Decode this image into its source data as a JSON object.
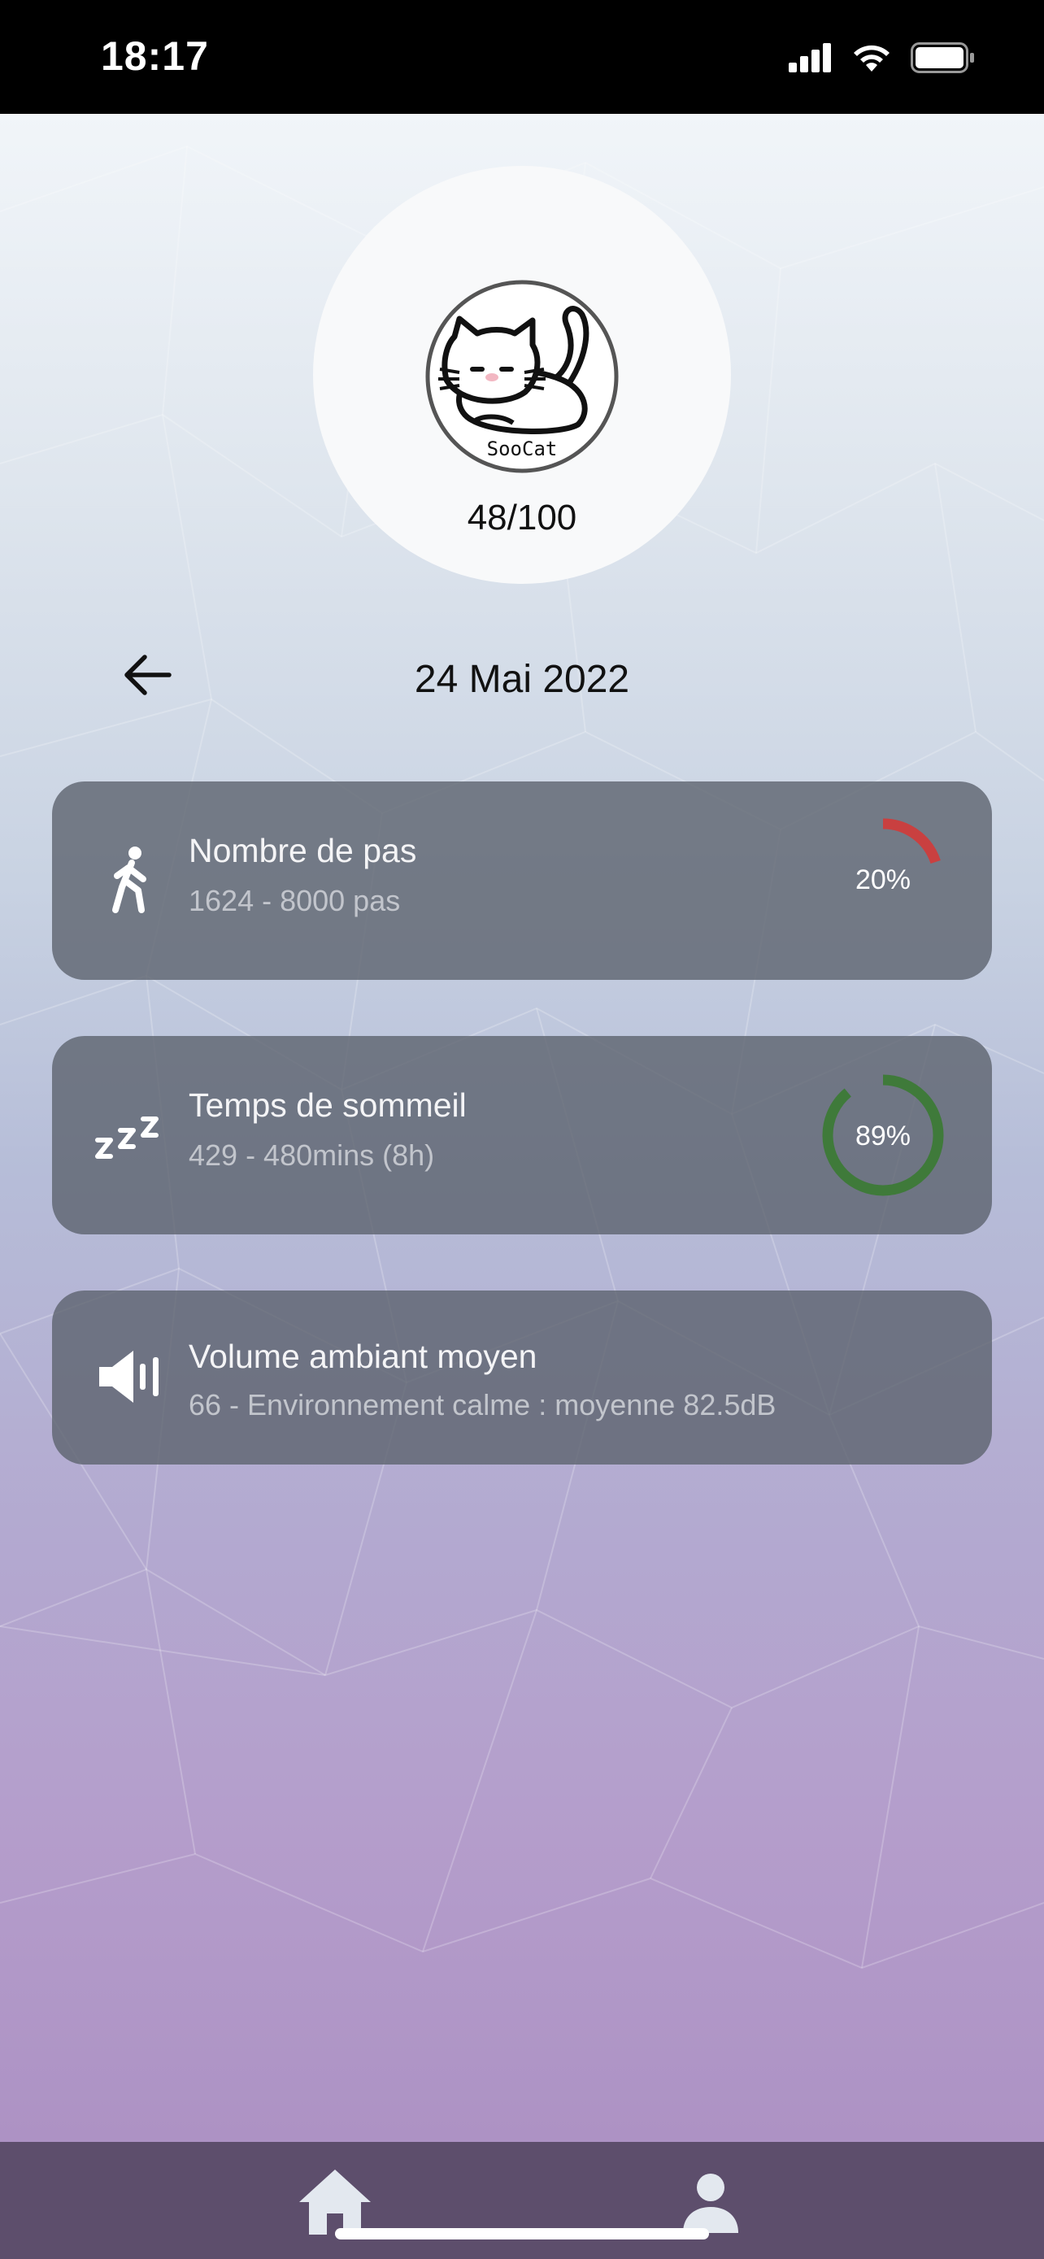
{
  "status_bar": {
    "time": "18:17"
  },
  "profile": {
    "logo_text": "SooCat",
    "score": "48/100"
  },
  "date_nav": {
    "date": "24 Mai 2022",
    "back_icon": "arrow-left-icon"
  },
  "cards": [
    {
      "title": "Nombre de pas",
      "subtitle": "1624 - 8000 pas",
      "icon": "walking-icon",
      "percent_label": "20%",
      "progress": 0.2,
      "color": "#c94040"
    },
    {
      "title": "Temps de sommeil",
      "subtitle": "429 - 480mins (8h)",
      "icon": "sleep-zzz-icon",
      "percent_label": "89%",
      "progress": 0.89,
      "color": "#3f7a3a"
    },
    {
      "title": "Volume ambiant moyen",
      "subtitle": "66 - Environnement calme : moyenne 82.5dB",
      "icon": "speaker-icon"
    }
  ],
  "bottom_nav": {
    "home_icon": "home-icon",
    "profile_icon": "profile-icon"
  },
  "colors": {
    "nav_bg": "#5d4e6c",
    "card_bg": "#5c636e"
  }
}
